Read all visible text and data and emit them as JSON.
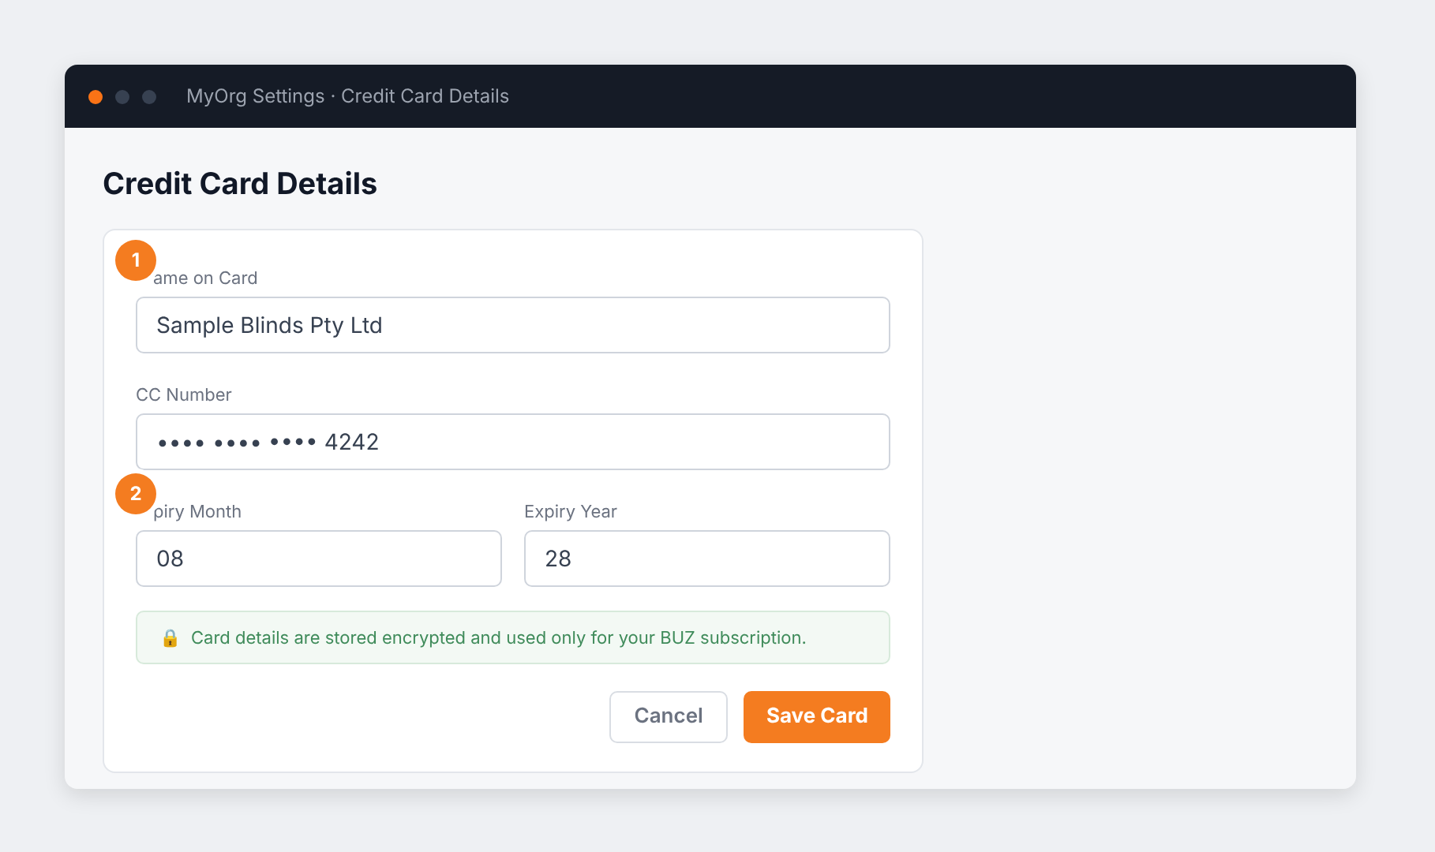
{
  "window": {
    "title": "MyOrg Settings · Credit Card Details",
    "dots": [
      {
        "color": "#f97316"
      },
      {
        "color": "#374151"
      },
      {
        "color": "#374151"
      }
    ]
  },
  "heading": "Credit Card Details",
  "fields": [
    {
      "label": "ame on Card",
      "value": "Sample Blinds Pty Ltd",
      "badge": "1"
    },
    {
      "label": "CC Number",
      "value": "•••• •••• •••• 4242"
    }
  ],
  "expiry": [
    {
      "label": "piry Month",
      "value": "08",
      "badge": "2"
    },
    {
      "label": "Expiry Year",
      "value": "28"
    }
  ],
  "notice": {
    "icon": "🔒",
    "text": "Card details are stored encrypted and used only for your BUZ subscription."
  },
  "buttons": [
    {
      "label": "Cancel",
      "kind": "secondary"
    },
    {
      "label": "Save Card",
      "kind": "primary"
    }
  ]
}
